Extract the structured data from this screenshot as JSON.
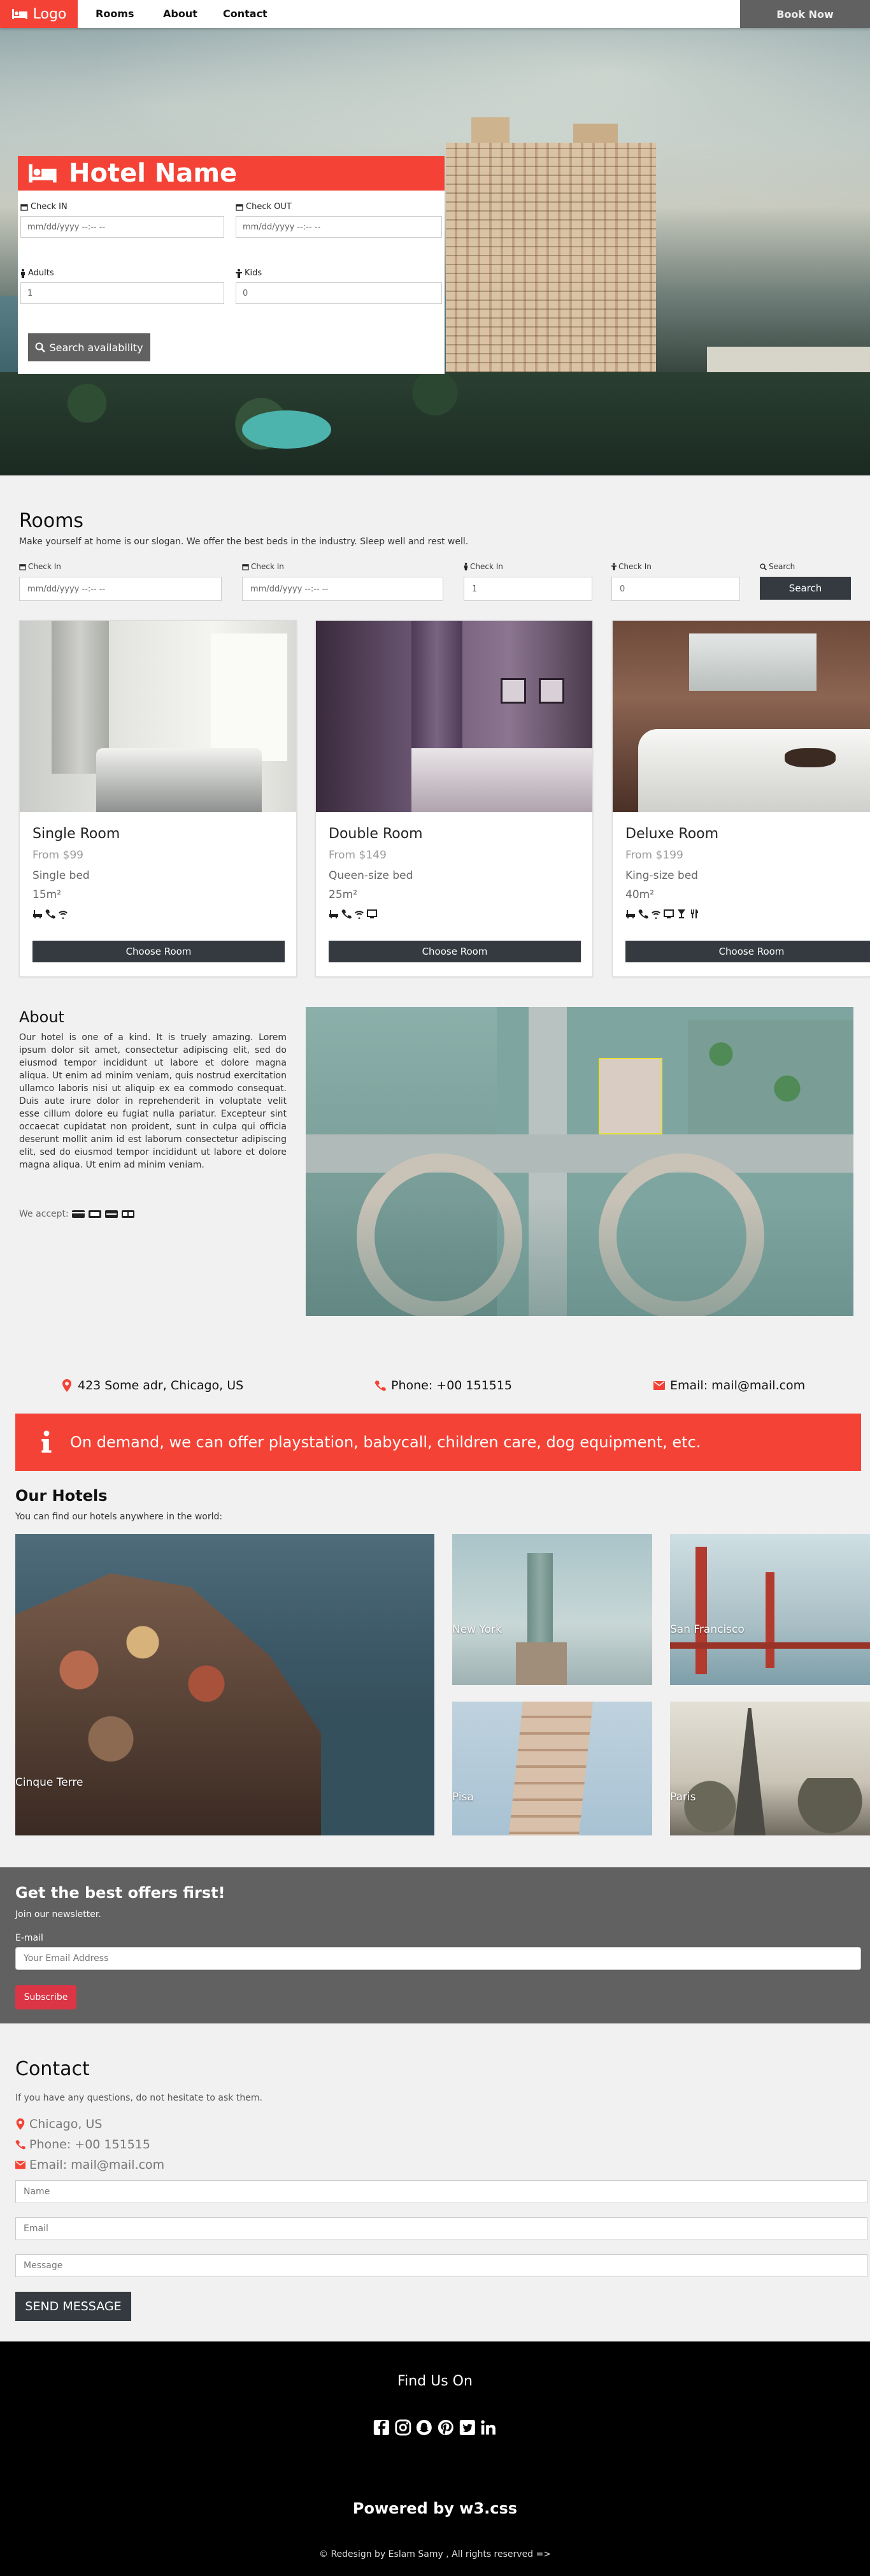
{
  "nav": {
    "logo": "Logo",
    "links": [
      "Rooms",
      "About",
      "Contact"
    ],
    "book": "Book Now"
  },
  "booking": {
    "title": "Hotel Name",
    "check_in_label": "Check IN",
    "check_out_label": "Check OUT",
    "date_placeholder": "mm/dd/yyyy --:-- --",
    "adults_label": "Adults",
    "kids_label": "Kids",
    "adults_value": "1",
    "kids_value": "0",
    "search_button": "Search availability"
  },
  "rooms": {
    "title": "Rooms",
    "slogan": "Make yourself at home is our slogan. We offer the best beds in the industry. Sleep well and rest well.",
    "search": {
      "check_in_label": "Check In",
      "date_placeholder": "mm/dd/yyyy --:-- --",
      "adults_value": "1",
      "kids_value": "0",
      "search_label": "Search",
      "button": "Search"
    },
    "cards": [
      {
        "title": "Single Room",
        "price": "From $99",
        "bed": "Single bed",
        "size": "15m²",
        "button": "Choose Room",
        "amenities": [
          "bath-icon",
          "phone-icon",
          "wifi-icon"
        ]
      },
      {
        "title": "Double Room",
        "price": "From $149",
        "bed": "Queen-size bed",
        "size": "25m²",
        "button": "Choose Room",
        "amenities": [
          "bath-icon",
          "phone-icon",
          "wifi-icon",
          "tv-icon"
        ]
      },
      {
        "title": "Deluxe Room",
        "price": "From $199",
        "bed": "King-size bed",
        "size": "40m²",
        "button": "Choose Room",
        "amenities": [
          "bath-icon",
          "phone-icon",
          "wifi-icon",
          "tv-icon",
          "glass-icon",
          "cutlery-icon"
        ]
      }
    ]
  },
  "about": {
    "title": "About",
    "text": "Our hotel is one of a kind. It is truely amazing. Lorem ipsum dolor sit amet, consectetur adipiscing elit, sed do eiusmod tempor incididunt ut labore et dolore magna aliqua. Ut enim ad minim veniam, quis nostrud exercitation ullamco laboris nisi ut aliquip ex ea commodo consequat. Duis aute irure dolor in reprehenderit in voluptate velit esse cillum dolore eu fugiat nulla pariatur. Excepteur sint occaecat cupidatat non proident, sunt in culpa qui officia deserunt mollit anim id est laborum consectetur adipiscing elit, sed do eiusmod tempor incididunt ut labore et dolore magna aliqua. Ut enim ad minim veniam.",
    "accept": "We accept:"
  },
  "contact_row": {
    "address": "423 Some adr, Chicago, US",
    "phone": "Phone: +00 151515",
    "email": "Email: mail@mail.com"
  },
  "demand": "On demand, we can offer playstation, babycall, children care, dog equipment, etc.",
  "hotels": {
    "title": "Our Hotels",
    "subtitle": "You can find our hotels anywhere in the world:",
    "places": [
      "Cinque Terre",
      "New York",
      "San Francisco",
      "Pisa",
      "Paris"
    ]
  },
  "newsletter": {
    "title": "Get the best offers first!",
    "subtitle": "Join our newsletter.",
    "label": "E-mail",
    "placeholder": "Your Email Address",
    "button": "Subscribe"
  },
  "contact": {
    "title": "Contact",
    "subtitle": "If you have any questions, do not hesitate to ask them.",
    "city": "Chicago, US",
    "phone": "Phone: +00 151515",
    "email": "Email: mail@mail.com",
    "name_placeholder": "Name",
    "email_placeholder": "Email",
    "message_placeholder": "Message",
    "send": "SEND MESSAGE"
  },
  "footer": {
    "find": "Find Us On",
    "powered": "Powered by w3.css",
    "copyright": "© Redesign by Eslam Samy , All rights reserved =>"
  },
  "colors": {
    "accent": "#f44336",
    "dark": "#343a40",
    "grey": "#616161",
    "subscribe": "#dc3545"
  }
}
